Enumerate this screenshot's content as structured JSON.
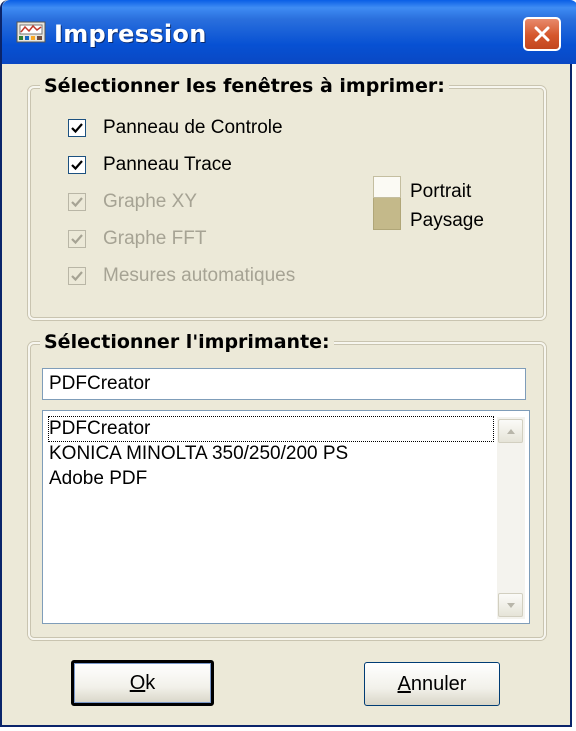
{
  "window": {
    "title": "Impression"
  },
  "windows_group": {
    "title": "Sélectionner les fenêtres à imprimer:",
    "checkboxes": [
      {
        "label": "Panneau de Controle",
        "checked": true,
        "enabled": true
      },
      {
        "label": "Panneau Trace",
        "checked": true,
        "enabled": true
      },
      {
        "label": "Graphe XY",
        "checked": true,
        "enabled": false
      },
      {
        "label": "Graphe FFT",
        "checked": true,
        "enabled": false
      },
      {
        "label": "Mesures automatiques",
        "checked": true,
        "enabled": false
      }
    ],
    "orientation": {
      "portrait_label": "Portrait",
      "landscape_label": "Paysage"
    }
  },
  "printer_group": {
    "title": "Sélectionner l'imprimante:",
    "selected_value": "PDFCreator",
    "printers": [
      "PDFCreator",
      "KONICA MINOLTA 350/250/200 PS",
      "Adobe PDF"
    ]
  },
  "buttons": {
    "ok_mnemonic": "O",
    "ok_rest": "k",
    "cancel_mnemonic": "A",
    "cancel_rest": "nnuler"
  },
  "colors": {
    "titlebar": "#0751d3",
    "dialog_bg": "#ece9d8",
    "close_button": "#d5572c"
  }
}
